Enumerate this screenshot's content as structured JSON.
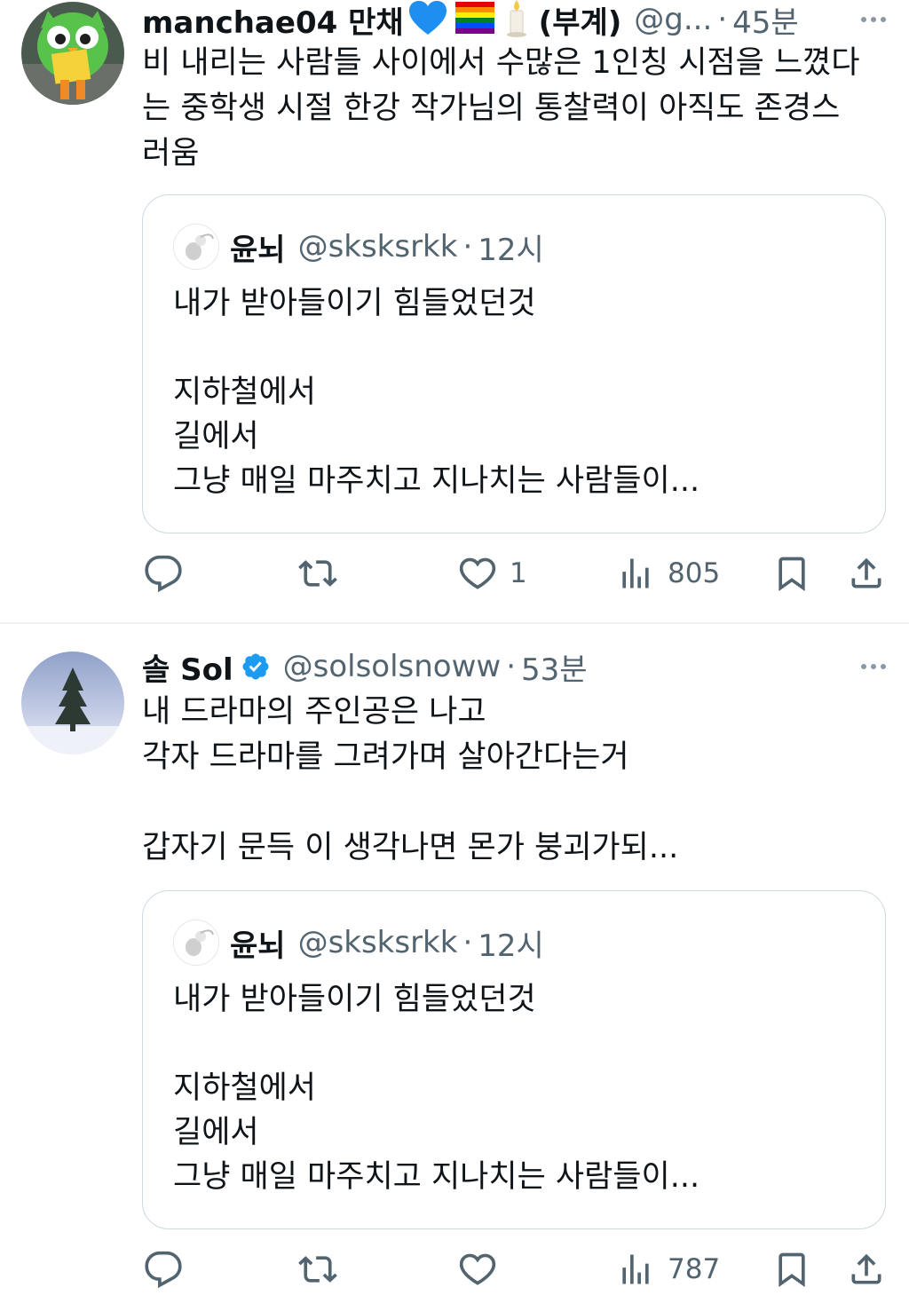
{
  "tweets": [
    {
      "name": "manchae04 만채",
      "handle": "@g...",
      "sep": "·",
      "time": "45분",
      "sub_name": "(부계)",
      "text": [
        "비 내리는 사람들 사이에서 수많은 1인칭 시점을 느꼈다",
        "는 중학생 시절 한강 작가님의 통찰력이 아직도 존경스",
        "러움"
      ],
      "quote": {
        "name": "윤뇌",
        "handle": "@sksksrkk",
        "sep": "·",
        "time": "12시",
        "lines": [
          "내가 받아들이기 힘들었던것",
          "",
          "지하철에서",
          "길에서",
          "그냥 매일 마주치고 지나치는 사람들이..."
        ]
      },
      "actions": {
        "replies": "",
        "reposts": "",
        "likes": "1",
        "views": "805"
      },
      "like_color": "#536471"
    },
    {
      "name": "솔 Sol",
      "handle": "@solsolsnoww",
      "sep": "·",
      "time": "53분",
      "verified": true,
      "text": [
        "내 드라마의 주인공은 나고",
        "각자 드라마를 그려가며 살아간다는거",
        "",
        "갑자기 문득 이 생각나면 몬가 붕괴가되..."
      ],
      "quote": {
        "name": "윤뇌",
        "handle": "@sksksrkk",
        "sep": "·",
        "time": "12시",
        "lines": [
          "내가 받아들이기 힘들었던것",
          "",
          "지하철에서",
          "길에서",
          "그냥 매일 마주치고 지나치는 사람들이..."
        ]
      },
      "actions": {
        "replies": "",
        "reposts": "",
        "likes": "",
        "views": "787"
      }
    }
  ],
  "colors": {
    "text": "#0f1419",
    "secondary": "#536471",
    "border": "#cfd9de",
    "verified": "#1d9bf0"
  },
  "icons": [
    "reply-icon",
    "repost-icon",
    "like-icon",
    "views-icon",
    "bookmark-icon",
    "share-icon",
    "more-icon",
    "verified-icon"
  ]
}
